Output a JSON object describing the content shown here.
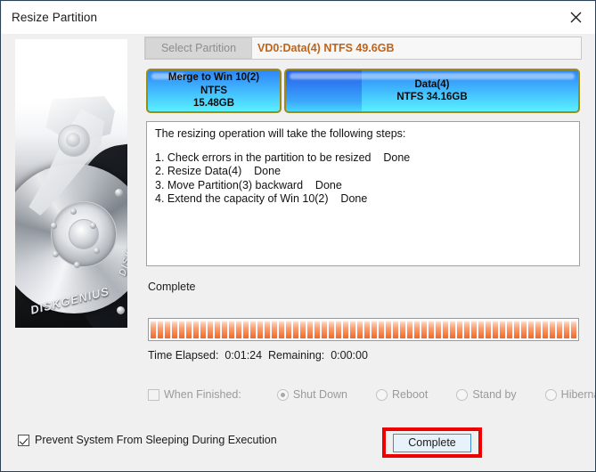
{
  "window": {
    "title": "Resize Partition",
    "close_icon": "close-icon"
  },
  "disk": {
    "brand": "DISKGENIUS",
    "brand_secondary": "DISKGENIUS"
  },
  "header": {
    "select_partition_label": "Select Partition",
    "partition_info": "VD0:Data(4) NTFS 49.6GB",
    "partition_info_color": "#c06316"
  },
  "partitions": [
    {
      "name": "Merge to Win 10(2)",
      "filesystem": "NTFS",
      "size": "15.48GB",
      "selected": true
    },
    {
      "name": "Data(4)",
      "filesystem_and_size": "NTFS 34.16GB",
      "selected": false
    }
  ],
  "steps": {
    "intro": "The resizing operation will take the following steps:",
    "items": [
      "1. Check errors in the partition to be resized    Done",
      "2. Resize Data(4)    Done",
      "3. Move Partition(3) backward    Done",
      "4. Extend the capacity of Win 10(2)    Done"
    ]
  },
  "status": {
    "text": "Complete",
    "progress_percent": 100,
    "time_text": "Time Elapsed:  0:01:24  Remaining:  0:00:00",
    "progress_color": "#f5713a"
  },
  "when_finished": {
    "checkbox_label": "When Finished:",
    "checkbox_checked": false,
    "options": [
      {
        "label": "Shut Down",
        "selected": true
      },
      {
        "label": "Reboot",
        "selected": false
      },
      {
        "label": "Stand by",
        "selected": false
      },
      {
        "label": "Hibernate",
        "selected": false
      }
    ]
  },
  "footer": {
    "prevent_sleep_label": "Prevent System From Sleeping During Execution",
    "prevent_sleep_checked": true,
    "complete_button_label": "Complete",
    "highlight_color": "#ee0000"
  }
}
